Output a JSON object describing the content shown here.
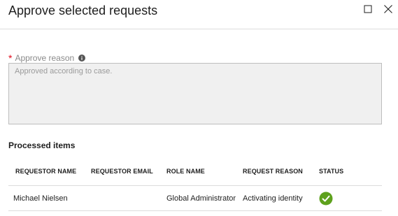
{
  "dialog": {
    "title": "Approve selected requests"
  },
  "reason_field": {
    "label": "Approve reason",
    "required_marker": "*",
    "info_icon": "info-icon",
    "placeholder": "Approved according to case.",
    "value": ""
  },
  "processed": {
    "section_title": "Processed items",
    "columns": [
      "REQUESTOR NAME",
      "REQUESTOR EMAIL",
      "ROLE NAME",
      "REQUEST REASON",
      "STATUS"
    ],
    "rows": [
      {
        "requestor_name": "Michael Nielsen",
        "requestor_email": "",
        "role_name": "Global Administrator",
        "request_reason": "Activating identity",
        "status_icon": "success-check-icon",
        "status_color": "#5ea11d"
      }
    ]
  },
  "colors": {
    "required": "#e00b1c",
    "textarea_bg": "#f0f0f0",
    "success": "#5ea11d"
  }
}
